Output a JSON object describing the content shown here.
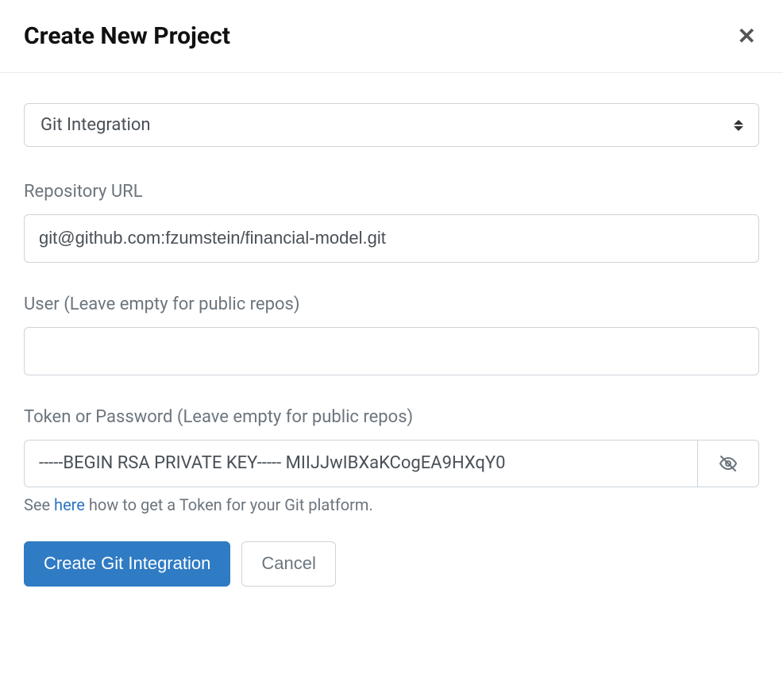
{
  "header": {
    "title": "Create New Project"
  },
  "form": {
    "integration_type": "Git Integration",
    "repo_url_label": "Repository URL",
    "repo_url_value": "git@github.com:fzumstein/financial-model.git",
    "user_label": "User (Leave empty for public repos)",
    "user_value": "",
    "token_label": "Token or Password (Leave empty for public repos)",
    "token_value": "-----BEGIN RSA PRIVATE KEY----- MIIJJwIBXaKCogEA9HXqY0",
    "help_prefix": "See ",
    "help_link_text": "here",
    "help_suffix": " how to get a Token for your Git platform."
  },
  "buttons": {
    "submit_label": "Create Git Integration",
    "cancel_label": "Cancel"
  }
}
